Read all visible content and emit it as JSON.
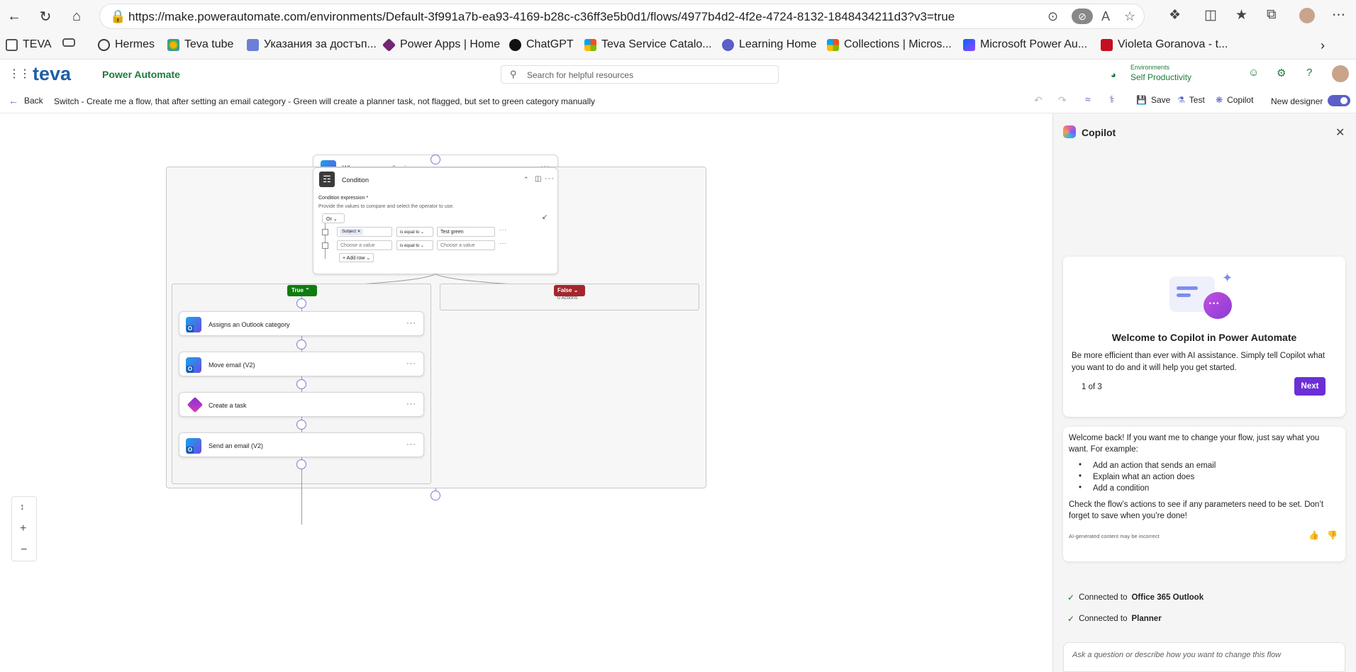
{
  "browser": {
    "url": "https://make.powerautomate.com/environments/Default-3f991a7b-ea93-4169-b28c-c36ff3e5b0d1/flows/4977b4d2-4f2e-4724-8132-1848434211d3?v3=true",
    "bookmarks": [
      {
        "label": "TEVA",
        "color": "#555555"
      },
      {
        "label": "",
        "color": "#555555"
      },
      {
        "label": "Hermes",
        "color": "#3a3a3a"
      },
      {
        "label": "Teva tube",
        "color": "#e6a100"
      },
      {
        "label": "Указания за достъп...",
        "color": "#6c7fd6"
      },
      {
        "label": "Power Apps | Home",
        "color": "#742774"
      },
      {
        "label": "ChatGPT",
        "color": "#111111"
      },
      {
        "label": "Teva Service Catalo...",
        "color": "#d83b01"
      },
      {
        "label": "Learning Home",
        "color": "#5b5fc7"
      },
      {
        "label": "Collections | Micros...",
        "color": "#d83b01"
      },
      {
        "label": "Microsoft Power Au...",
        "color": "#0066ff"
      },
      {
        "label": "Violeta Goranova - t...",
        "color": "#c50f1f"
      }
    ]
  },
  "header": {
    "logo": "teva",
    "app_name": "Power Automate",
    "search_placeholder": "Search for helpful resources",
    "env_label": "Environments",
    "env_name": "Self Productivity"
  },
  "command_bar": {
    "back": "Back",
    "flow_title": "Switch - Create me a flow, that after setting an email category - Green will create a planner task, not flagged, but set to green category manually",
    "save": "Save",
    "test": "Test",
    "copilot": "Copilot",
    "new_designer": "New designer"
  },
  "flow": {
    "trigger": "When a new email arrives",
    "condition": {
      "title": "Condition",
      "expr_label": "Condition expression *",
      "expr_hint": "Provide the values to compare and select the operator to use.",
      "group_op": "Or",
      "row1_token": "Subject",
      "row1_op": "is equal to",
      "row1_value": "Test green",
      "row2_placeholder_left": "Choose a value",
      "row2_op": "is equal to",
      "row2_placeholder_right": "Choose a value",
      "add_row": "Add row"
    },
    "true_label": "True",
    "false_label": "False",
    "false_actions": "0 Actions",
    "true_actions": [
      "Assigns an Outlook category",
      "Move email (V2)",
      "Create a task",
      "Send an email (V2)"
    ]
  },
  "copilot": {
    "title": "Copilot",
    "welcome_title": "Welcome to Copilot in Power Automate",
    "welcome_text": "Be more efficient than ever with AI assistance. Simply tell Copilot what you want to do and it will help you get started.",
    "pager": "1 of 3",
    "next": "Next",
    "msg_intro": "Welcome back! If you want me to change your flow, just say what you want. For example:",
    "msg_bullets": [
      "Add an action that sends an email",
      "Explain what an action does",
      "Add a condition"
    ],
    "msg_outro": "Check the flow’s actions to see if any parameters need to be set. Don’t forget to save when you’re done!",
    "disclaimer": "AI-generated content may be incorrect",
    "connected_prefix": "Connected to",
    "connections": [
      "Office 365 Outlook",
      "Planner"
    ],
    "input_placeholder": "Ask a question or describe how you want to change this flow"
  },
  "colors": {
    "accent": "#5b5fc7",
    "brand_green": "#1c7c3a",
    "true_green": "#107c10",
    "false_red": "#a4262c",
    "next_purple": "#6b2fd6"
  }
}
